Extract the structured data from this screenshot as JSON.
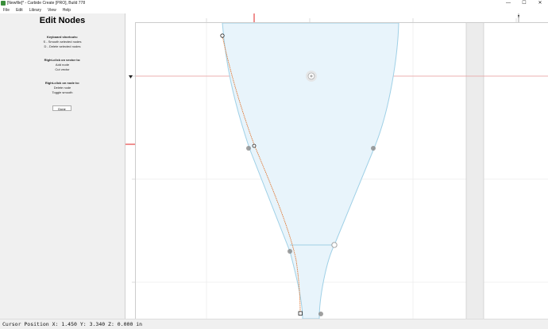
{
  "window": {
    "title": "[Newfile]* - Carbide Create [PRO], Build 778",
    "minimize_glyph": "—",
    "maximize_glyph": "☐",
    "close_glyph": "✕",
    "app_icon": "carbide-create-icon"
  },
  "menu": {
    "items": [
      "File",
      "Edit",
      "Library",
      "View",
      "Help"
    ]
  },
  "panel": {
    "title": "Edit Nodes",
    "sections": [
      {
        "header": "Keyboard shortcuts:",
        "lines": [
          "S - Smooth selected nodes",
          "D - Delete selected nodes"
        ]
      },
      {
        "header": "Right-click on vector to:",
        "lines": [
          "Add node",
          "Cut vector"
        ]
      },
      {
        "header": "Right-click on node to:",
        "lines": [
          "Delete node",
          "Toggle smooth"
        ]
      }
    ],
    "done_label": "Done"
  },
  "status": {
    "cursor_text": "Cursor Position X: 1.450 Y: 3.340 Z: 0.000 in"
  },
  "colors": {
    "shape_fill": "#e8f4fb",
    "shape_stroke": "#9fd0e6",
    "edit_path": "#e07b39",
    "grid": "#e6e6e6",
    "axis_x": "#e89b9b",
    "axis_y": "#9fd89f",
    "ruler_marker": "#e02020"
  }
}
